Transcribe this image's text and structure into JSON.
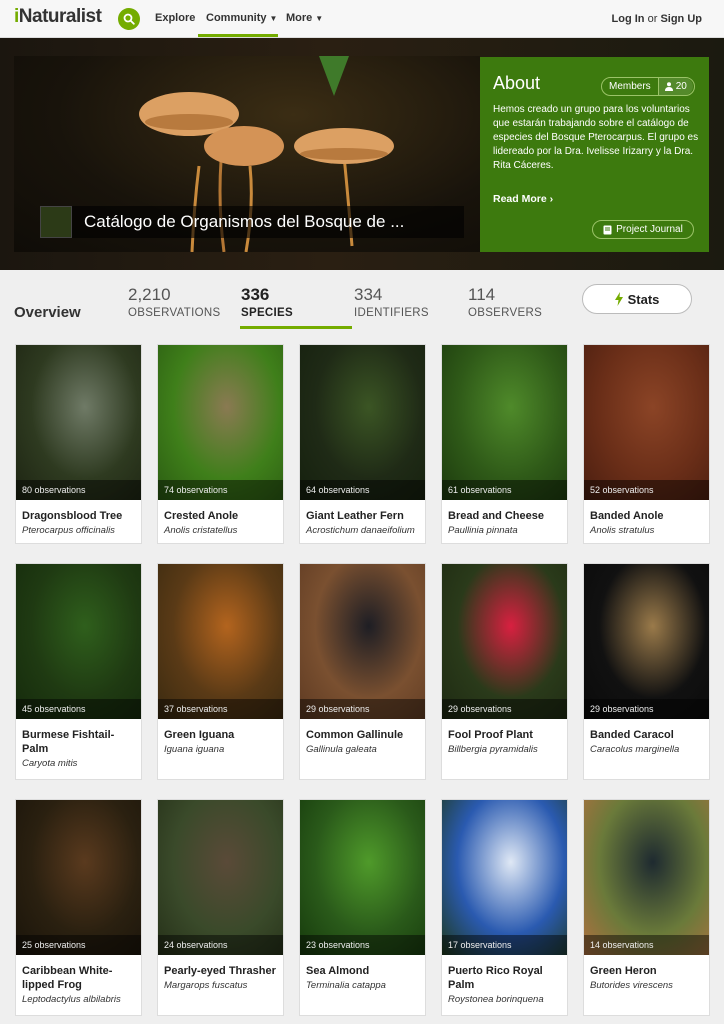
{
  "nav": {
    "logo_i": "i",
    "logo_rest": "Naturalist",
    "explore": "Explore",
    "community": "Community",
    "more": "More",
    "login": "Log In",
    "or": "or",
    "signup": "Sign Up"
  },
  "hero": {
    "title": "Catálogo de Organismos del Bosque de ..."
  },
  "about": {
    "heading": "About",
    "members_label": "Members",
    "members_count": "20",
    "description": "Hemos creado un grupo para los voluntarios que estarán trabajando sobre el catálogo de especies del Bosque Pterocarpus. El grupo es lidereado por la Dra. Ivelisse Irizarry y la Dra. Rita Cáceres.",
    "read_more": "Read More",
    "project_journal": "Project Journal"
  },
  "stats": {
    "overview": "Overview",
    "observations_num": "2,210",
    "observations_lbl": "OBSERVATIONS",
    "species_num": "336",
    "species_lbl": "SPECIES",
    "identifiers_num": "334",
    "identifiers_lbl": "IDENTIFIERS",
    "observers_num": "114",
    "observers_lbl": "OBSERVERS",
    "stats_button": "Stats"
  },
  "species": [
    {
      "obs": "80 observations",
      "name": "Dragonsblood Tree",
      "sci": "Pterocarpus officinalis",
      "colors": [
        "#2e3a20",
        "#6f7a66",
        "#1d2412"
      ]
    },
    {
      "obs": "74 observations",
      "name": "Crested Anole",
      "sci": "Anolis cristatellus",
      "colors": [
        "#3f7f1a",
        "#8a7a52",
        "#2b5c12"
      ]
    },
    {
      "obs": "64 observations",
      "name": "Giant Leather Fern",
      "sci": "Acrostichum danaeifolium",
      "colors": [
        "#1f2a16",
        "#3b5524",
        "#15200e"
      ]
    },
    {
      "obs": "61 observations",
      "name": "Bread and Cheese",
      "sci": "Paullinia pinnata",
      "colors": [
        "#2f5a18",
        "#4f8a2a",
        "#1c3a0e"
      ]
    },
    {
      "obs": "52 observations",
      "name": "Banded Anole",
      "sci": "Anolis stratulus",
      "colors": [
        "#6a2e18",
        "#8b4426",
        "#4a1e10"
      ]
    },
    {
      "obs": "45 observations",
      "name": "Burmese Fishtail-Palm",
      "sci": "Caryota mitis",
      "colors": [
        "#1f3a12",
        "#2f5f1c",
        "#152a0c"
      ]
    },
    {
      "obs": "37 observations",
      "name": "Green Iguana",
      "sci": "Iguana iguana",
      "colors": [
        "#5a3a16",
        "#b3641e",
        "#3a2a10"
      ]
    },
    {
      "obs": "29 observations",
      "name": "Common Gallinule",
      "sci": "Gallinula galeata",
      "colors": [
        "#7a5030",
        "#1e1e24",
        "#5e3a22"
      ]
    },
    {
      "obs": "29 observations",
      "name": "Fool Proof Plant",
      "sci": "Billbergia pyramidalis",
      "colors": [
        "#2a3a1a",
        "#d82040",
        "#1e2a12"
      ]
    },
    {
      "obs": "29 observations",
      "name": "Banded Caracol",
      "sci": "Caracolus marginella",
      "colors": [
        "#111111",
        "#9a7a4a",
        "#0a0a0a"
      ]
    },
    {
      "obs": "25 observations",
      "name": "Caribbean White-lipped Frog",
      "sci": "Leptodactylus albilabris",
      "colors": [
        "#2a2010",
        "#5a3a1e",
        "#1a140a"
      ]
    },
    {
      "obs": "24 observations",
      "name": "Pearly-eyed Thrasher",
      "sci": "Margarops fuscatus",
      "colors": [
        "#3a4a2a",
        "#5a4a38",
        "#253018"
      ]
    },
    {
      "obs": "23 observations",
      "name": "Sea Almond",
      "sci": "Terminalia catappa",
      "colors": [
        "#2a5a1a",
        "#4f9a2a",
        "#163a0c"
      ]
    },
    {
      "obs": "17 observations",
      "name": "Puerto Rico Royal Palm",
      "sci": "Roystonea borinquena",
      "colors": [
        "#2a5ab0",
        "#dfe8f5",
        "#1e3a1a"
      ]
    },
    {
      "obs": "14 observations",
      "name": "Green Heron",
      "sci": "Butorides virescens",
      "colors": [
        "#6a7a3a",
        "#1e2a30",
        "#b07040"
      ]
    }
  ]
}
